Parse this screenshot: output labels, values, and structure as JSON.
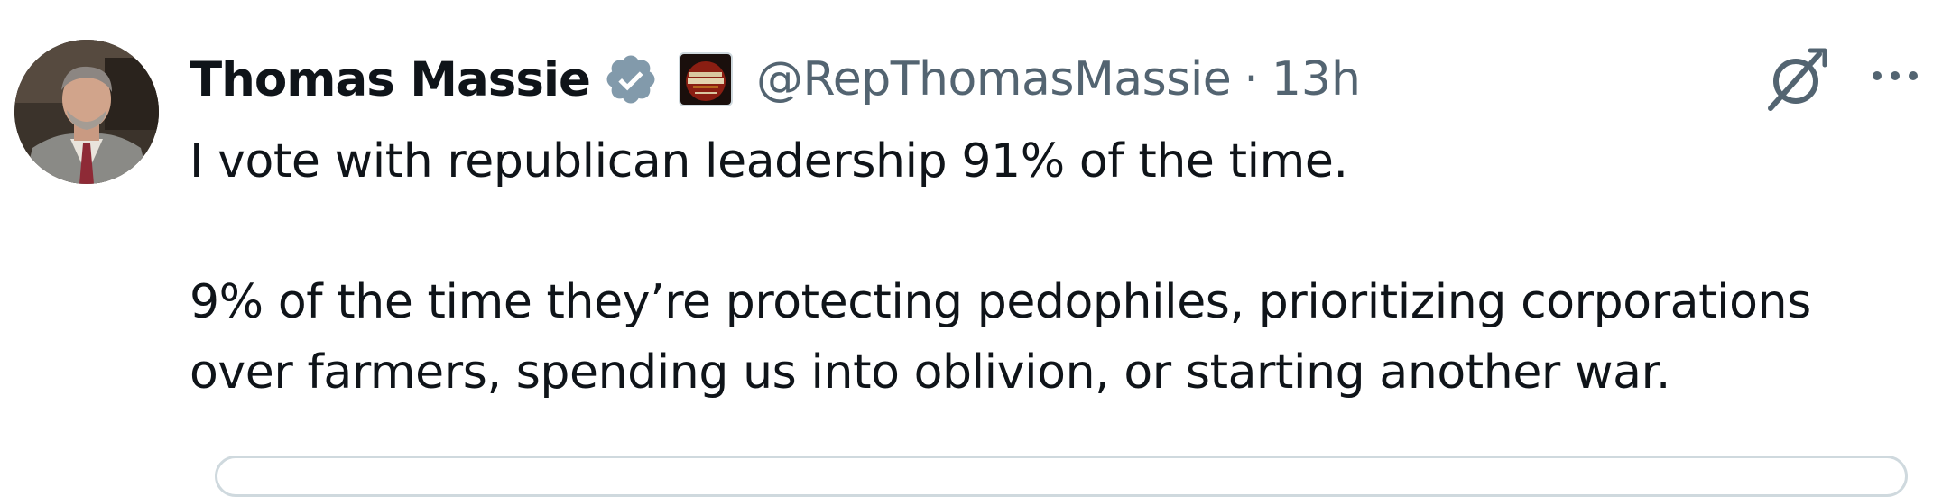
{
  "tweet": {
    "display_name": "Thomas Massie",
    "handle": "@RepThomasMassie",
    "separator": "·",
    "time": "13h",
    "paragraphs": [
      "I vote with republican leadership 91% of the time.",
      "9% of the time they’re protecting pedophiles, prioritizing corporations\nover farmers, spending us into oblivion, or starting another war."
    ]
  },
  "icons": {
    "verified": "verified-badge-icon",
    "affiliate": "affiliate-badge-icon",
    "grok": "grok-icon",
    "more": "more-options-icon"
  },
  "colors": {
    "text": "#0f1419",
    "secondary": "#536471",
    "verified_badge": "#829aab",
    "border": "#cfd9de"
  }
}
